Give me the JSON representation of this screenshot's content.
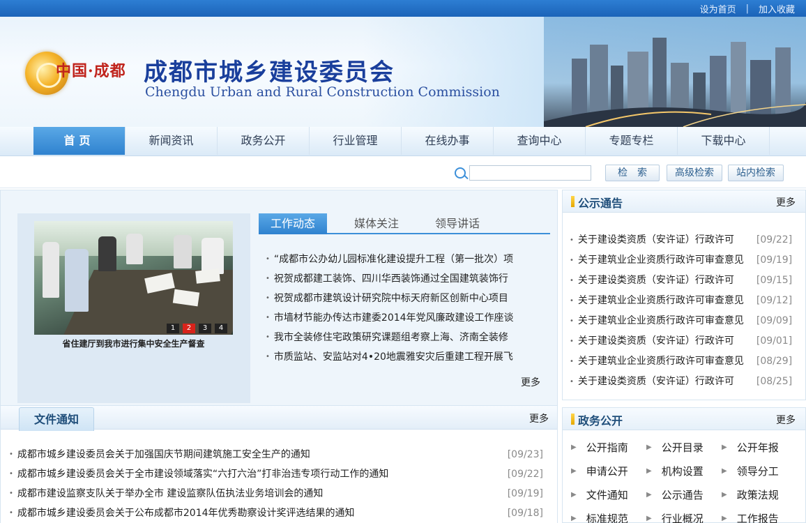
{
  "top_links": [
    "设为首页",
    "加入收藏"
  ],
  "top_sep": "|",
  "banner": {
    "logo_text": "中国·成都",
    "title_cn": "成都市城乡建设委员会",
    "title_en": "Chengdu Urban and Rural Construction Commission"
  },
  "nav": [
    "首页",
    "新闻资讯",
    "政务公开",
    "行业管理",
    "在线办事",
    "查询中心",
    "专题专栏",
    "下载中心"
  ],
  "search": {
    "value": "",
    "buttons": [
      "检　索",
      "高级检索",
      "站内检索"
    ]
  },
  "photo": {
    "caption": "省住建厅到我市进行集中安全生产督查",
    "pages": [
      "1",
      "2",
      "3",
      "4"
    ],
    "active_page": "2"
  },
  "news": {
    "tabs": [
      "工作动态",
      "媒体关注",
      "领导讲话"
    ],
    "active_tab": "工作动态",
    "items": [
      "“成都市公办幼儿园标准化建设提升工程（第一批次）项",
      "祝贺成都建工装饰、四川华西装饰通过全国建筑装饰行",
      "祝贺成都市建筑设计研究院中标天府新区创新中心项目",
      "市墙材节能办传达市建委2014年党风廉政建设工作座谈",
      "我市全装修住宅政策研究课题组考察上海、济南全装修",
      "市质监站、安监站对4•20地震雅安灾后重建工程开展飞"
    ],
    "more": "更多"
  },
  "docs": {
    "title": "文件通知",
    "more": "更多",
    "items": [
      {
        "title": "成都市城乡建设委员会关于加强国庆节期间建筑施工安全生产的通知",
        "date": "[09/23]"
      },
      {
        "title": "成都市城乡建设委员会关于全市建设领域落实“六打六治”打非治违专项行动工作的通知",
        "date": "[09/22]"
      },
      {
        "title": "成都市建设监察支队关于举办全市 建设监察队伍执法业务培训会的通知",
        "date": "[09/19]"
      },
      {
        "title": "成都市城乡建设委员会关于公布成都市2014年优秀勘察设计奖评选结果的通知",
        "date": "[09/18]"
      }
    ]
  },
  "notices": {
    "title": "公示通告",
    "more": "更多",
    "items": [
      {
        "title": "关于建设类资质（安许证）行政许可",
        "date": "[09/22]"
      },
      {
        "title": "关于建筑业企业资质行政许可审查意见",
        "date": "[09/19]"
      },
      {
        "title": "关于建设类资质（安许证）行政许可",
        "date": "[09/15]"
      },
      {
        "title": "关于建筑业企业资质行政许可审查意见",
        "date": "[09/12]"
      },
      {
        "title": "关于建筑业企业资质行政许可审查意见",
        "date": "[09/09]"
      },
      {
        "title": "关于建设类资质（安许证）行政许可",
        "date": "[09/01]"
      },
      {
        "title": "关于建筑业企业资质行政许可审查意见",
        "date": "[08/29]"
      },
      {
        "title": "关于建设类资质（安许证）行政许可",
        "date": "[08/25]"
      }
    ]
  },
  "gov": {
    "title": "政务公开",
    "more": "更多",
    "items": [
      "公开指南",
      "公开目录",
      "公开年报",
      "申请公开",
      "机构设置",
      "领导分工",
      "文件通知",
      "公示通告",
      "政策法规",
      "标准规范",
      "行业概况",
      "工作报告"
    ]
  },
  "colors": {
    "accent": "#2f82cf",
    "top_bar": "#1b63b8",
    "title_blue": "#1a3f9c",
    "logo_red": "#c0241c",
    "date_gray": "#8a8a8a"
  }
}
